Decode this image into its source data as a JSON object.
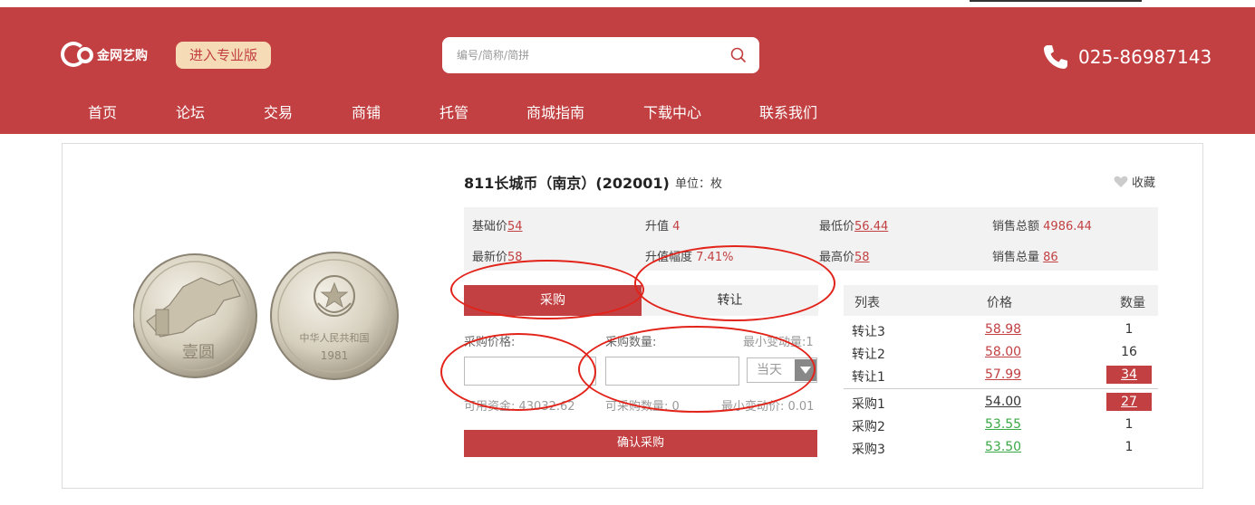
{
  "header": {
    "logo_text": "金网艺购",
    "pro_button": "进入专业版",
    "search_placeholder": "编号/简称/简拼",
    "phone": "025-86987143"
  },
  "nav": [
    "首页",
    "论坛",
    "交易",
    "商铺",
    "托管",
    "商城指南",
    "下载中心",
    "联系我们"
  ],
  "product": {
    "title": "811长城币（南京）(202001)",
    "unit": "单位：枚",
    "favorite": "收藏",
    "coin_left_text": "壹圆",
    "coin_right_text": "中华人民共和国",
    "coin_right_year": "1981"
  },
  "stats": {
    "base_label": "基础价",
    "base_value": "54",
    "rise_label": "升值",
    "rise_value": "4",
    "low_label": "最低价",
    "low_value": "56.44",
    "sales_amount_label": "销售总额",
    "sales_amount_value": "4986.44",
    "latest_label": "最新价",
    "latest_value": "58",
    "rise_pct_label": "升值幅度",
    "rise_pct_value": "7.41%",
    "high_label": "最高价",
    "high_value": "58",
    "sales_qty_label": "销售总量",
    "sales_qty_value": "86"
  },
  "trade": {
    "tab_buy": "采购",
    "tab_sell": "转让",
    "price_label": "采购价格:",
    "qty_label": "采购数量:",
    "min_change_qty": "最小变动量:1",
    "period": "当天",
    "available_funds": "可用资金: 43032.62",
    "buyable_qty": "可采购数量: 0",
    "min_change_price": "最小变动价: 0.01",
    "confirm": "确认采购"
  },
  "orderbook": {
    "headers": [
      "列表",
      "价格",
      "数量"
    ],
    "rows": [
      {
        "name": "转让3",
        "price": "58.98",
        "qty": "1",
        "highlight": false,
        "color": "#c24042"
      },
      {
        "name": "转让2",
        "price": "58.00",
        "qty": "16",
        "highlight": false,
        "color": "#c24042"
      },
      {
        "name": "转让1",
        "price": "57.99",
        "qty": "34",
        "highlight": true,
        "color": "#c24042"
      },
      {
        "name": "采购1",
        "price": "54.00",
        "qty": "27",
        "highlight": true,
        "color": "#333333"
      },
      {
        "name": "采购2",
        "price": "53.55",
        "qty": "1",
        "highlight": false,
        "color": "#3aa845"
      },
      {
        "name": "采购3",
        "price": "53.50",
        "qty": "1",
        "highlight": false,
        "color": "#3aa845"
      }
    ]
  },
  "colors": {
    "brand": "#c24042",
    "pro_bg": "#f6dcb6",
    "annotation": "#e2231a",
    "green": "#3aa845"
  }
}
